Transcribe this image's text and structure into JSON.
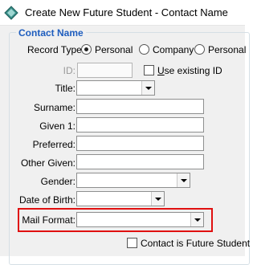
{
  "window": {
    "title": "Create New Future Student - Contact Name",
    "app_icon": "diamond-app-icon"
  },
  "group": {
    "title": "Contact Name"
  },
  "record_type": {
    "label": "Record Type:",
    "options": [
      {
        "label": "Personal",
        "selected": true
      },
      {
        "label": "Company",
        "selected": false
      },
      {
        "label": "Personal",
        "selected": false
      }
    ]
  },
  "id_field": {
    "label": "ID:",
    "value": ""
  },
  "use_existing_id": {
    "label": "Use existing ID",
    "checked": false
  },
  "fields": {
    "title": {
      "label": "Title:",
      "value": ""
    },
    "surname": {
      "label": "Surname:",
      "value": ""
    },
    "given1": {
      "label": "Given 1:",
      "value": ""
    },
    "preferred": {
      "label": "Preferred:",
      "value": ""
    },
    "other_given": {
      "label": "Other Given:",
      "value": ""
    },
    "gender": {
      "label": "Gender:",
      "value": ""
    },
    "dob": {
      "label": "Date of Birth:",
      "value": ""
    },
    "mail_format": {
      "label": "Mail Format:",
      "value": ""
    }
  },
  "contact_future_student": {
    "label": "Contact is Future Student",
    "checked": false
  },
  "colors": {
    "highlight": "#e01010",
    "group_title": "#1e5dbe"
  }
}
